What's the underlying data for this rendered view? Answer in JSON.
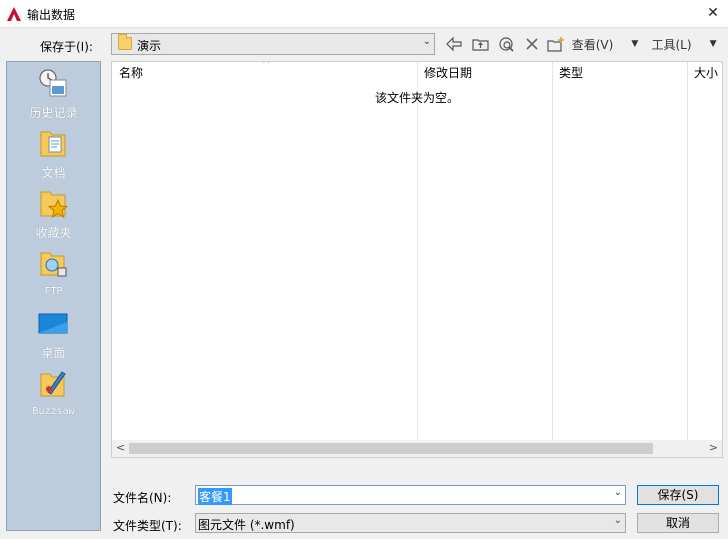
{
  "window": {
    "title": "输出数据",
    "close_glyph": "✕"
  },
  "save_in": {
    "label": "保存于(I):",
    "folder": "演示"
  },
  "toolbar": {
    "view_label": "查看(V)",
    "tools_label": "工具(L)"
  },
  "places": [
    {
      "label": "历史记录",
      "icon": "history-icon"
    },
    {
      "label": "文档",
      "icon": "documents-icon"
    },
    {
      "label": "收藏夹",
      "icon": "favorites-icon"
    },
    {
      "label": "FTP",
      "icon": "ftp-icon"
    },
    {
      "label": "桌面",
      "icon": "desktop-icon"
    },
    {
      "label": "Buzzsaw",
      "icon": "buzzsaw-icon"
    }
  ],
  "filelist": {
    "columns": [
      "名称",
      "修改日期",
      "类型",
      "大小"
    ],
    "empty_message": "该文件夹为空。"
  },
  "file_name": {
    "label": "文件名(N):",
    "value": "客餐1"
  },
  "file_type": {
    "label": "文件类型(T):",
    "value": "图元文件 (*.wmf)"
  },
  "buttons": {
    "save": "保存(S)",
    "cancel": "取消"
  },
  "colors": {
    "accent": "#0078d7",
    "places_bg": "#bdccdc",
    "selection": "#3399ff"
  }
}
